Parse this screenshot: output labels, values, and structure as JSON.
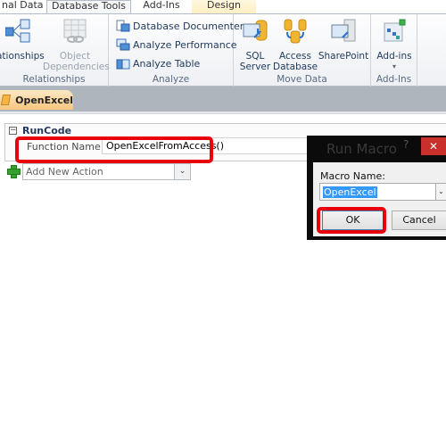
{
  "ribbon_tabs": [
    {
      "label": "nal Data"
    },
    {
      "label": "Database Tools",
      "active": true
    },
    {
      "label": "Add-Ins"
    },
    {
      "label": "Design",
      "contextual": true
    }
  ],
  "ribbon_groups": {
    "relationships": {
      "label": "Relationships",
      "buttons": [
        {
          "label": "ationships",
          "icon": "relationships-icon"
        },
        {
          "label_line1": "Object",
          "label_line2": "Dependencies",
          "icon": "object-dependencies-icon",
          "disabled": true
        }
      ]
    },
    "analyze": {
      "label": "Analyze",
      "buttons": [
        {
          "label": "Database Documenter",
          "icon": "database-documenter-icon"
        },
        {
          "label": "Analyze Performance",
          "icon": "analyze-performance-icon"
        },
        {
          "label": "Analyze Table",
          "icon": "analyze-table-icon"
        }
      ]
    },
    "move_data": {
      "label": "Move Data",
      "buttons": [
        {
          "label_line1": "SQL",
          "label_line2": "Server",
          "icon": "sql-server-icon"
        },
        {
          "label_line1": "Access",
          "label_line2": "Database",
          "icon": "access-database-icon"
        },
        {
          "label_line1": "SharePoint",
          "label_line2": "",
          "icon": "sharepoint-icon"
        }
      ]
    },
    "addins": {
      "label": "Add-Ins",
      "buttons": [
        {
          "label_line1": "Add-ins",
          "label_line2": "▾",
          "icon": "add-ins-icon"
        }
      ]
    }
  },
  "document_tab": {
    "label": "OpenExcel",
    "icon": "macro-icon"
  },
  "macro": {
    "action_name": "RunCode",
    "collapse_glyph": "−",
    "argument_label": "Function Name",
    "argument_value": "OpenExcelFromAccess()",
    "add_action_placeholder": "Add New Action",
    "dropdown_glyph": "⌄"
  },
  "dialog": {
    "title": "Run Macro",
    "help_glyph": "?",
    "close_glyph": "✕",
    "field_label": "Macro Name:",
    "field_value": "OpenExcel",
    "dropdown_glyph": "⌄",
    "ok_label": "OK",
    "cancel_label": "Cancel"
  },
  "highlight_color": "#e8000b"
}
